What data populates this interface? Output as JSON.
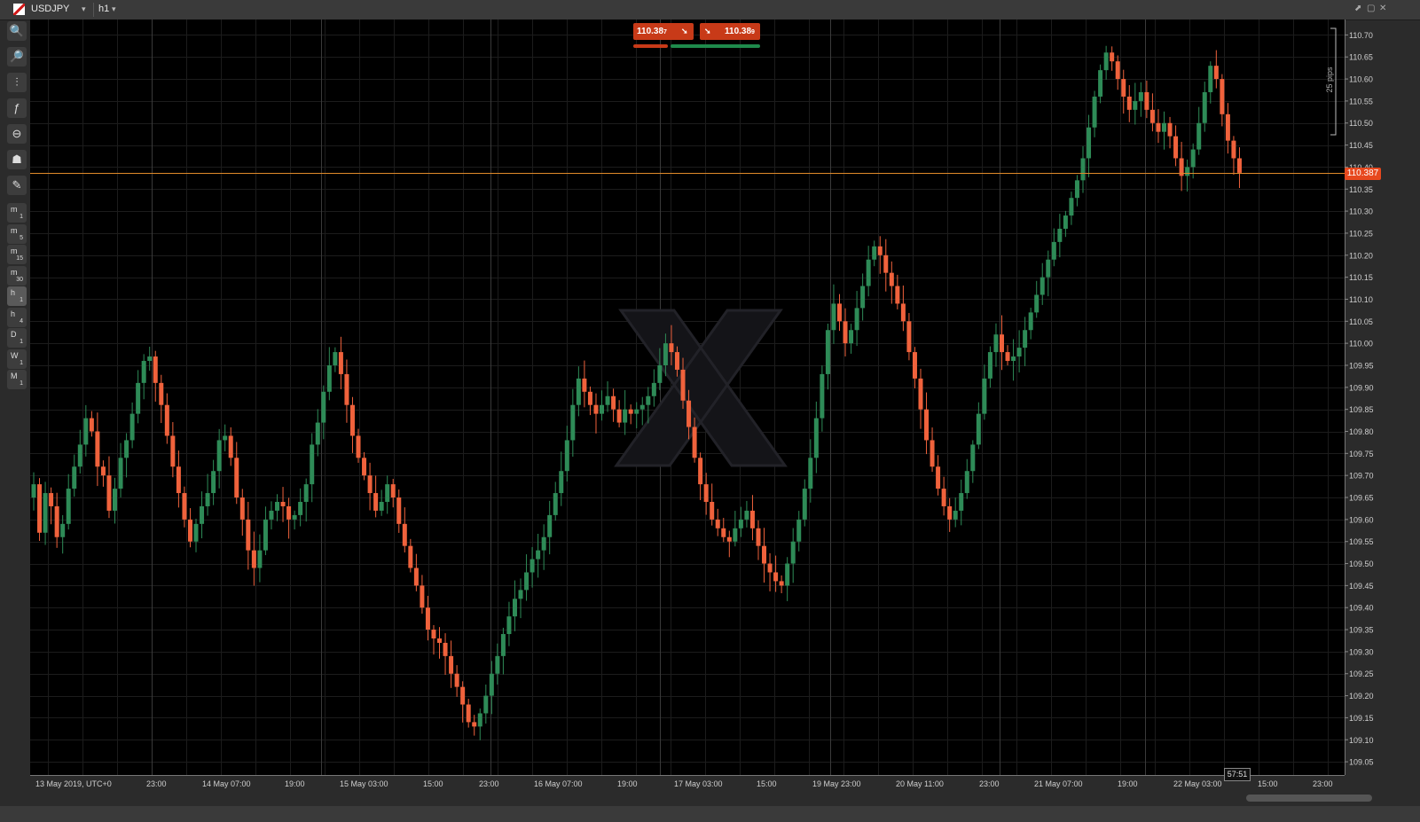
{
  "header": {
    "symbol": "USDJPY",
    "timeframe": "h1",
    "dropdown_glyph": "▾",
    "window_buttons": [
      "⬈",
      "▢",
      "✕"
    ]
  },
  "toolbar": {
    "tools": [
      {
        "name": "zoom-in-icon",
        "glyph": "🔍"
      },
      {
        "name": "zoom-out-icon",
        "glyph": "🔎"
      },
      {
        "name": "chart-type-icon",
        "glyph": "⫶"
      },
      {
        "name": "indicators-icon",
        "glyph": "ƒ"
      },
      {
        "name": "link-icon",
        "glyph": "⊖"
      },
      {
        "name": "template-icon",
        "glyph": "☗"
      },
      {
        "name": "drawing-settings-icon",
        "glyph": "✎"
      }
    ],
    "timeframes": [
      {
        "a": "m",
        "b": "1"
      },
      {
        "a": "m",
        "b": "5"
      },
      {
        "a": "m",
        "b": "15"
      },
      {
        "a": "m",
        "b": "30"
      },
      {
        "a": "h",
        "b": "1"
      },
      {
        "a": "h",
        "b": "4"
      },
      {
        "a": "D",
        "b": "1"
      },
      {
        "a": "W",
        "b": "1"
      },
      {
        "a": "M",
        "b": "1"
      }
    ],
    "selected_timeframe_index": 4
  },
  "trade": {
    "sell_price": "110.38",
    "sell_sup": "7",
    "buy_price": "110.38",
    "buy_sup": "9",
    "arrow_glyph": "➘",
    "sell_fraction": 0.27
  },
  "timer": "57:51",
  "pips_label": "25 pips",
  "chart_data": {
    "type": "candlestick",
    "symbol": "USDJPY",
    "timeframe": "h1",
    "current_price": 110.387,
    "current_price_label": "110.387",
    "ylim": [
      109.02,
      110.735
    ],
    "y_ticks": [
      "110.70",
      "110.65",
      "110.60",
      "110.55",
      "110.50",
      "110.45",
      "110.40",
      "110.35",
      "110.30",
      "110.25",
      "110.20",
      "110.15",
      "110.10",
      "110.05",
      "110.00",
      "109.95",
      "109.90",
      "109.85",
      "109.80",
      "109.75",
      "109.70",
      "109.65",
      "109.60",
      "109.55",
      "109.50",
      "109.45",
      "109.40",
      "109.35",
      "109.30",
      "109.25",
      "109.20",
      "109.15",
      "109.10",
      "109.05"
    ],
    "x_labels": [
      "13 May 2019, UTC+0",
      "23:00",
      "14 May 07:00",
      "19:00",
      "15 May 03:00",
      "15:00",
      "23:00",
      "16 May 07:00",
      "19:00",
      "17 May 03:00",
      "15:00",
      "19 May 23:00",
      "20 May 11:00",
      "23:00",
      "21 May 07:00",
      "19:00",
      "22 May 03:00",
      "15:00",
      "23:00"
    ],
    "up_color": "#2e8b57",
    "down_color": "#f0623c",
    "price_line_color": "#e08a2a",
    "closes": [
      109.68,
      109.57,
      109.66,
      109.63,
      109.56,
      109.59,
      109.67,
      109.72,
      109.77,
      109.83,
      109.8,
      109.72,
      109.7,
      109.62,
      109.67,
      109.74,
      109.78,
      109.84,
      109.91,
      109.96,
      109.97,
      109.91,
      109.86,
      109.79,
      109.72,
      109.66,
      109.6,
      109.55,
      109.59,
      109.63,
      109.66,
      109.71,
      109.78,
      109.79,
      109.74,
      109.65,
      109.6,
      109.53,
      109.49,
      109.53,
      109.6,
      109.62,
      109.64,
      109.63,
      109.6,
      109.61,
      109.64,
      109.68,
      109.77,
      109.82,
      109.89,
      109.95,
      109.98,
      109.93,
      109.86,
      109.79,
      109.74,
      109.7,
      109.66,
      109.62,
      109.64,
      109.68,
      109.65,
      109.59,
      109.54,
      109.49,
      109.45,
      109.4,
      109.35,
      109.33,
      109.32,
      109.29,
      109.25,
      109.22,
      109.18,
      109.14,
      109.13,
      109.16,
      109.2,
      109.25,
      109.29,
      109.34,
      109.38,
      109.42,
      109.44,
      109.48,
      109.51,
      109.53,
      109.56,
      109.61,
      109.66,
      109.71,
      109.78,
      109.86,
      109.92,
      109.89,
      109.86,
      109.84,
      109.86,
      109.88,
      109.85,
      109.82,
      109.85,
      109.84,
      109.85,
      109.86,
      109.88,
      109.91,
      109.95,
      110.0,
      109.98,
      109.94,
      109.87,
      109.81,
      109.74,
      109.68,
      109.64,
      109.6,
      109.58,
      109.56,
      109.55,
      109.58,
      109.6,
      109.62,
      109.58,
      109.54,
      109.5,
      109.48,
      109.46,
      109.45,
      109.5,
      109.55,
      109.6,
      109.67,
      109.74,
      109.83,
      109.93,
      110.03,
      110.09,
      110.05,
      110.0,
      110.03,
      110.08,
      110.13,
      110.19,
      110.22,
      110.2,
      110.16,
      110.13,
      110.09,
      110.05,
      109.98,
      109.92,
      109.85,
      109.78,
      109.72,
      109.67,
      109.63,
      109.6,
      109.62,
      109.66,
      109.71,
      109.77,
      109.84,
      109.92,
      109.98,
      110.02,
      109.98,
      109.96,
      109.97,
      109.99,
      110.03,
      110.07,
      110.11,
      110.15,
      110.19,
      110.23,
      110.26,
      110.29,
      110.33,
      110.37,
      110.42,
      110.49,
      110.56,
      110.62,
      110.66,
      110.64,
      110.6,
      110.56,
      110.53,
      110.55,
      110.57,
      110.53,
      110.5,
      110.48,
      110.5,
      110.47,
      110.42,
      110.38,
      110.4,
      110.44,
      110.5,
      110.57,
      110.63,
      110.6,
      110.52,
      110.46,
      110.42,
      110.387
    ]
  }
}
